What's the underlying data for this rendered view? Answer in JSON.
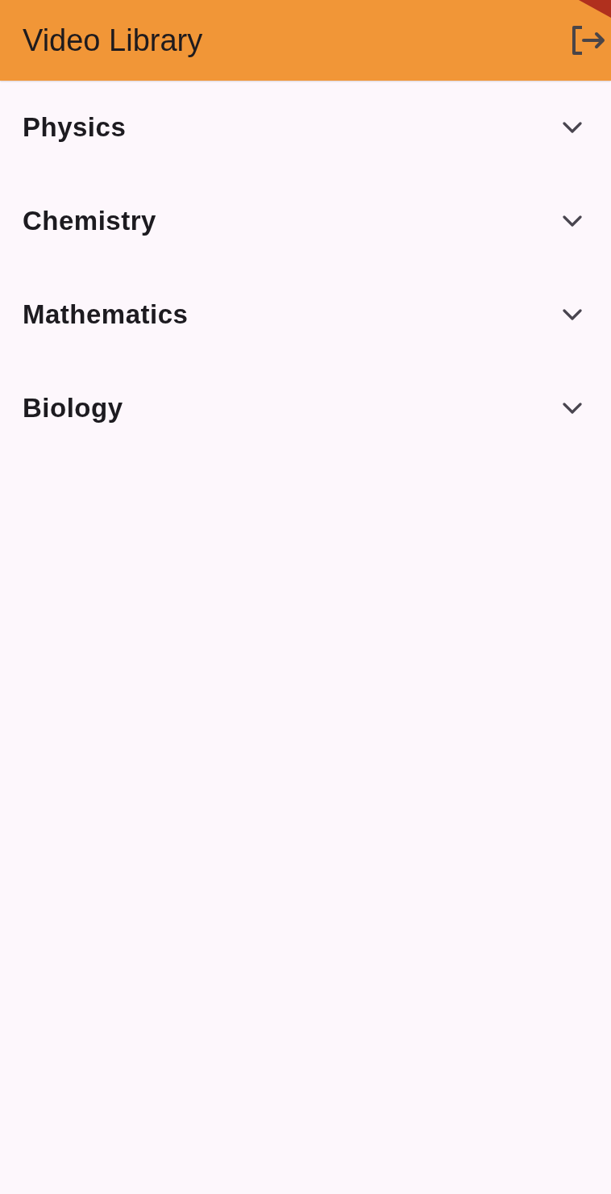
{
  "app_bar": {
    "title": "Video Library"
  },
  "subjects": [
    {
      "name": "Physics",
      "expanded": false
    },
    {
      "name": "Chemistry",
      "expanded": false
    },
    {
      "name": "Mathematics",
      "expanded": false
    },
    {
      "name": "Biology",
      "expanded": false
    }
  ]
}
